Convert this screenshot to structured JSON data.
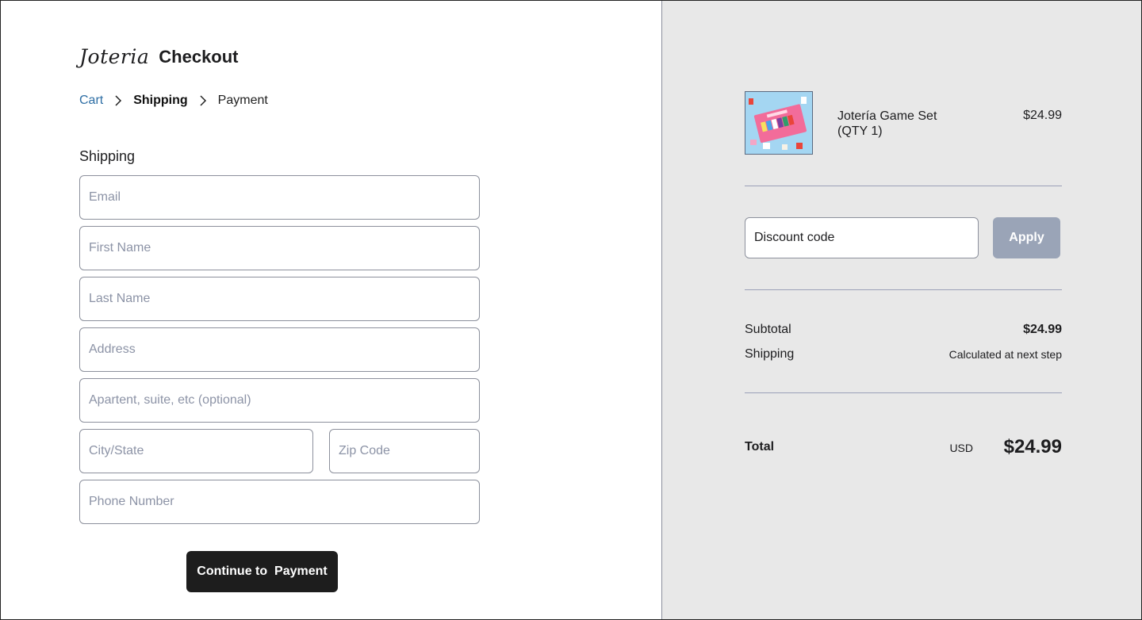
{
  "header": {
    "logo": "Joteria",
    "title": "Checkout"
  },
  "breadcrumb": {
    "cart": "Cart",
    "shipping": "Shipping",
    "payment": "Payment"
  },
  "shipping_form": {
    "section_title": "Shipping",
    "email_placeholder": "Email",
    "first_name_placeholder": "First Name",
    "last_name_placeholder": "Last Name",
    "address_placeholder": "Address",
    "apartment_placeholder": "Apartent, suite, etc (optional)",
    "city_state_placeholder": "City/State",
    "zip_placeholder": "Zip Code",
    "phone_placeholder": "Phone Number",
    "continue_label": "Continue to  Payment"
  },
  "order_summary": {
    "product": {
      "name": "Jotería Game Set (QTY 1)",
      "price": "$24.99"
    },
    "discount": {
      "placeholder": "Discount code",
      "apply_label": "Apply"
    },
    "subtotal_label": "Subtotal",
    "subtotal_value": "$24.99",
    "shipping_label": "Shipping",
    "shipping_value": "Calculated at next step",
    "total_label": "Total",
    "total_currency": "USD",
    "total_value": "$24.99"
  },
  "colors": {
    "link": "#2f6fa5",
    "primary_button": "#1d1d1d",
    "apply_button": "#9aa4b7",
    "summary_bg": "#e8e8e8",
    "divider": "#9aa0b8"
  }
}
